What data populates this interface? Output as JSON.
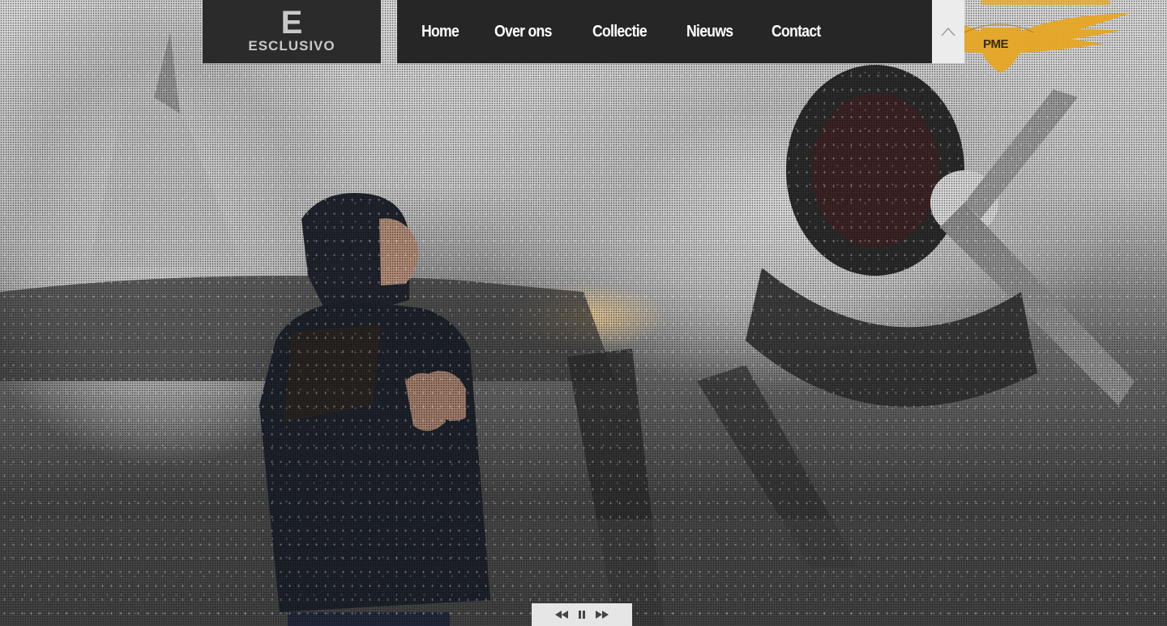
{
  "brand": {
    "logo_mark": "E",
    "logo_text": "ESCLUSIVO"
  },
  "nav": {
    "items": [
      {
        "label": "Home"
      },
      {
        "label": "Over ons"
      },
      {
        "label": "Collectie"
      },
      {
        "label": "Nieuws"
      },
      {
        "label": "Contact"
      }
    ]
  },
  "badge": {
    "label": "PME",
    "color": "#e7a621"
  },
  "icons": {
    "scroll_top": "chevron-up-icon",
    "prev": "rewind-icon",
    "pause": "pause-icon",
    "next": "fast-forward-icon"
  },
  "colors": {
    "nav_bg": "#262626",
    "logo_bg": "#2b2b2b",
    "nav_text": "#ffffff",
    "logo_text": "#c9c9c9"
  }
}
